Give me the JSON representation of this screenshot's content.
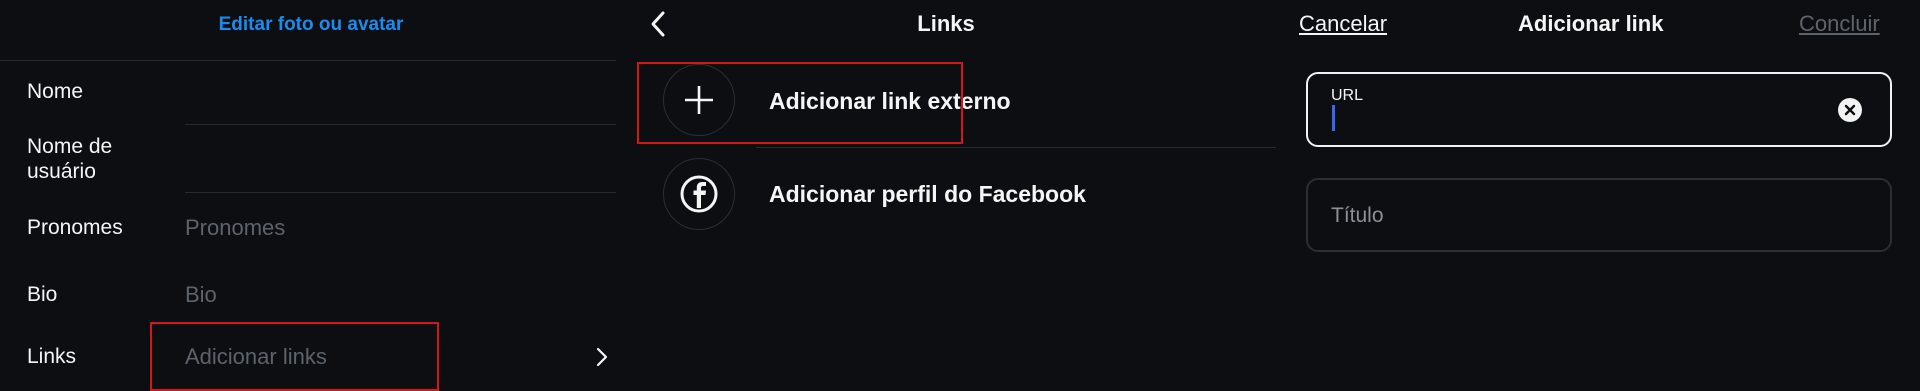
{
  "edit_profile": {
    "edit_photo_label": "Editar foto ou avatar",
    "rows": [
      {
        "label": "Nome",
        "value": ""
      },
      {
        "label_line1": "Nome de",
        "label_line2": "usuário",
        "value": ""
      },
      {
        "label": "Pronomes",
        "placeholder": "Pronomes"
      },
      {
        "label": "Bio",
        "placeholder": "Bio"
      },
      {
        "label": "Links",
        "placeholder": "Adicionar links"
      }
    ]
  },
  "links_screen": {
    "title": "Links",
    "options": [
      {
        "label": "Adicionar link externo",
        "icon": "plus-icon"
      },
      {
        "label": "Adicionar perfil do Facebook",
        "icon": "facebook-icon"
      }
    ]
  },
  "add_link_screen": {
    "cancel_label": "Cancelar",
    "title": "Adicionar link",
    "done_label": "Concluir",
    "url_field": {
      "label": "URL",
      "value": ""
    },
    "title_field": {
      "placeholder": "Título",
      "value": ""
    }
  },
  "colors": {
    "background": "#0c0e12",
    "accent_blue": "#1a8cf0",
    "highlight_red": "#d1181d",
    "muted_text": "#5d636b"
  }
}
